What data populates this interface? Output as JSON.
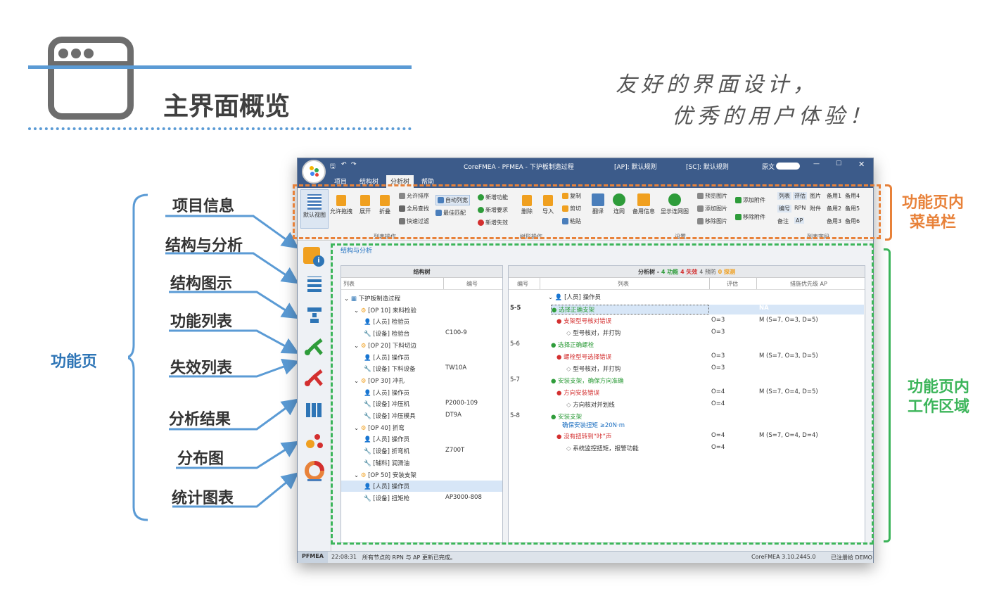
{
  "slide": {
    "title": "主界面概览",
    "slogan_line1": "友好的界面设计，",
    "slogan_line2": "优秀的用户体验！",
    "left_group": "功能页",
    "left_items": [
      "项目信息",
      "结构与分析",
      "结构图示",
      "功能列表",
      "失效列表",
      "分析结果",
      "分布图",
      "统计图表"
    ],
    "right_top": [
      "功能页内",
      "菜单栏"
    ],
    "right_bottom": [
      "功能页内",
      "工作区域"
    ]
  },
  "colors": {
    "accent_blue": "#5b9bd5",
    "label_orange": "#e8823a",
    "label_green": "#3cb55a",
    "titlebar": "#3c5b8a"
  },
  "app": {
    "title": "CoreFMEA - PFMEA - 下护板制造过程",
    "ap_rule": "[AP]: 默认规则",
    "sc_rule": "[SC]: 默认规则",
    "source_label": "原文",
    "tabs": [
      "项目",
      "结构树",
      "分析树",
      "帮助"
    ],
    "ribbon": {
      "g1": {
        "label": "列表操作",
        "buttons": [
          "默认视图",
          "允许拖拽",
          "展开",
          "折叠",
          "允许排序",
          "全局查找",
          "快速过滤",
          "自动列宽",
          "最佳匹配"
        ]
      },
      "g2": {
        "label": "",
        "buttons": [
          "新增功能",
          "新增要求",
          "新增失效"
        ]
      },
      "g3": {
        "label": "树形操作",
        "buttons": [
          "删除",
          "导入",
          "复制",
          "剪切",
          "粘贴"
        ]
      },
      "g4": {
        "label": "设置",
        "buttons": [
          "翻译",
          "连网",
          "备用信息",
          "显示连网图",
          "预览图片",
          "添加图片",
          "移除图片",
          "添加附件",
          "移除附件"
        ]
      },
      "g5": {
        "label": "列表字段",
        "buttons": [
          "列表",
          "评估",
          "图片",
          "备用1",
          "备用4",
          "编号",
          "RPN",
          "附件",
          "备用2",
          "备用5",
          "备注",
          "AP",
          "备用3",
          "备用6"
        ]
      }
    },
    "breadcrumb": "结构与分析",
    "structure_tree": {
      "title": "结构树",
      "col1": "列表",
      "col2": "编号",
      "rows": [
        {
          "t": "下护板制造过程",
          "code": "",
          "lvl": 0
        },
        {
          "t": "[OP 10] 来料检验",
          "code": "",
          "lvl": 1
        },
        {
          "t": "[人员] 检验员",
          "code": "",
          "lvl": 2
        },
        {
          "t": "[设备] 检验台",
          "code": "C100-9",
          "lvl": 2
        },
        {
          "t": "[OP 20] 下料切边",
          "code": "",
          "lvl": 1
        },
        {
          "t": "[人员] 操作员",
          "code": "",
          "lvl": 2
        },
        {
          "t": "[设备] 下料设备",
          "code": "TW10A",
          "lvl": 2
        },
        {
          "t": "[OP 30] 冲孔",
          "code": "",
          "lvl": 1
        },
        {
          "t": "[人员] 操作员",
          "code": "",
          "lvl": 2
        },
        {
          "t": "[设备] 冲压机",
          "code": "P2000-109",
          "lvl": 2
        },
        {
          "t": "[设备] 冲压模具",
          "code": "DT9A",
          "lvl": 2
        },
        {
          "t": "[OP 40] 折弯",
          "code": "",
          "lvl": 1
        },
        {
          "t": "[人员] 操作员",
          "code": "",
          "lvl": 2
        },
        {
          "t": "[设备] 折弯机",
          "code": "Z700T",
          "lvl": 2
        },
        {
          "t": "[辅料] 润滑油",
          "code": "",
          "lvl": 2
        },
        {
          "t": "[OP 50] 安装支架",
          "code": "",
          "lvl": 1
        },
        {
          "t": "[人员] 操作员",
          "code": "",
          "lvl": 2
        },
        {
          "t": "[设备] 扭矩枪",
          "code": "AP3000-808",
          "lvl": 2
        }
      ]
    },
    "analysis_tree": {
      "title": "分析树",
      "sep": "-",
      "func": "4 功能",
      "fail": "4 失效",
      "prev": "4 预防",
      "det": "0 探测",
      "col_no": "编号",
      "col_list": "列表",
      "col_eval": "评估",
      "col_ap": "措施优先级 AP",
      "root": "[人员] 操作员",
      "rows": [
        {
          "no": "5-5",
          "t": "选择正确支架",
          "kind": "func",
          "eval": "",
          "ap": "NA"
        },
        {
          "no": "",
          "t": "支架型号核对错误",
          "kind": "fail",
          "eval": "O=3",
          "ap": "M  (S=7, O=3, D=5)"
        },
        {
          "no": "",
          "t": "型号核对，并打钩",
          "kind": "prev",
          "eval": "O=3",
          "ap": ""
        },
        {
          "no": "5-6",
          "t": "选择正确螺栓",
          "kind": "func",
          "eval": "",
          "ap": ""
        },
        {
          "no": "",
          "t": "螺栓型号选择错误",
          "kind": "fail",
          "eval": "O=3",
          "ap": "M  (S=7, O=3, D=5)"
        },
        {
          "no": "",
          "t": "型号核对，并打钩",
          "kind": "prev",
          "eval": "O=3",
          "ap": ""
        },
        {
          "no": "5-7",
          "t": "安装支架，确保方向准确",
          "kind": "func",
          "eval": "",
          "ap": ""
        },
        {
          "no": "",
          "t": "方向安装错误",
          "kind": "fail",
          "eval": "O=4",
          "ap": "M  (S=7, O=4, D=5)"
        },
        {
          "no": "",
          "t": "方向核对并划线",
          "kind": "prev",
          "eval": "O=4",
          "ap": ""
        },
        {
          "no": "5-8",
          "t": "安装支架",
          "kind": "func",
          "eval": "",
          "ap": ""
        },
        {
          "no": "",
          "t": "确保安装扭矩 ≥20N·m",
          "kind": "req",
          "eval": "",
          "ap": ""
        },
        {
          "no": "",
          "t": "没有扭转到“咔”声",
          "kind": "fail",
          "eval": "O=4",
          "ap": "M  (S=7, O=4, D=4)"
        },
        {
          "no": "",
          "t": "系统监控扭矩，报警功能",
          "kind": "prev",
          "eval": "O=4",
          "ap": ""
        }
      ]
    },
    "status": {
      "mode": "PFMEA",
      "time": "22:08:31",
      "msg": "所有节点的 RPN 与 AP 更新已完成。",
      "version": "CoreFMEA 3.10.2445.0",
      "reg": "已注册给 DEMO"
    }
  }
}
